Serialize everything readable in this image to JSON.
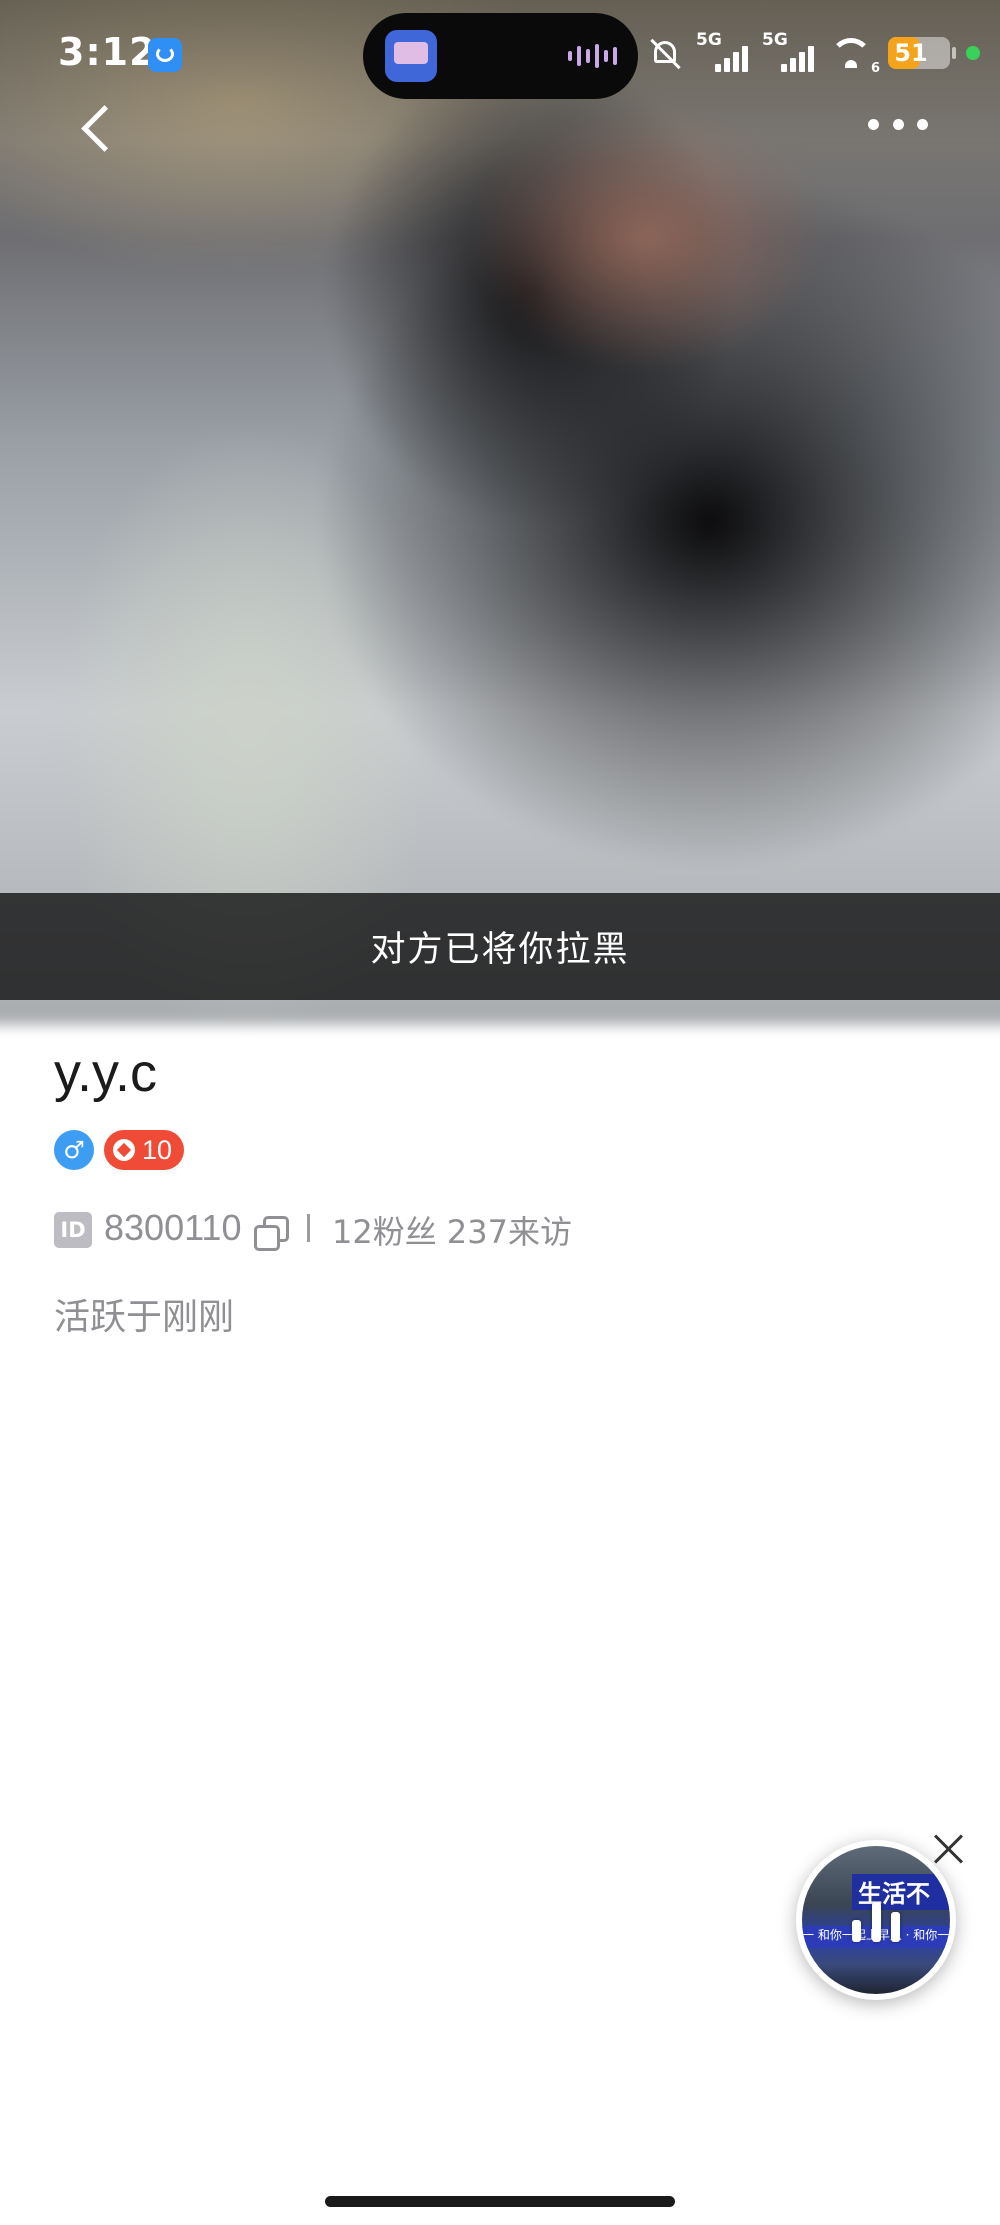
{
  "status_bar": {
    "time": "3:12",
    "signal_1_label": "5G",
    "signal_2_label": "5G",
    "wifi_badge": "6",
    "battery_level": "51",
    "battery_color": "#f5a31a",
    "privacy_dot_color": "#3ad15a"
  },
  "nav": {
    "back_icon": "chevron-left-icon",
    "more_icon": "more-horizontal-icon"
  },
  "banner": {
    "blocked_text": "对方已将你拉黑"
  },
  "profile": {
    "username": "y.y.c",
    "gender_symbol": "♂",
    "gender_color": "#3d9df2",
    "level": "10",
    "level_color": "#ef4b36",
    "id_tag": "ID",
    "id_value": "8300110",
    "stats": "12粉丝 237来访",
    "active_status": "活跃于刚刚"
  },
  "mini_player": {
    "thumb_sign": "生活不",
    "thumb_strip": "一 和你一起上早八 · 和你一起下午打工"
  }
}
